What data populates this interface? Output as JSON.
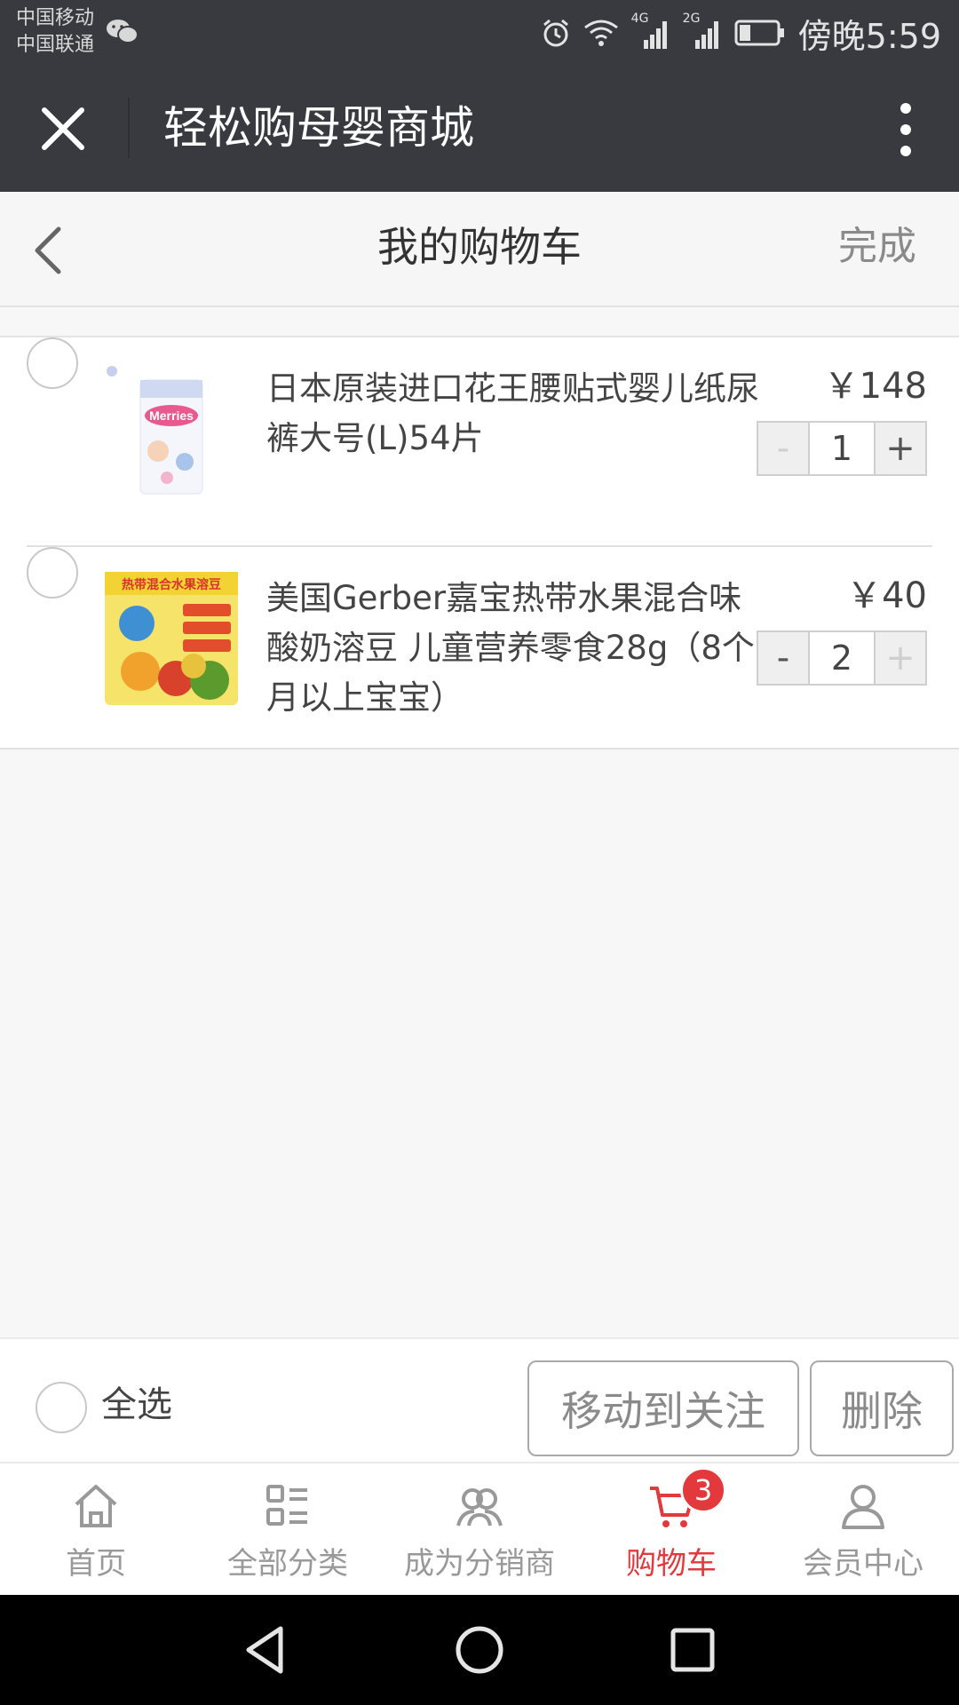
{
  "status_bar": {
    "carrier_1": "中国移动",
    "carrier_2": "中国联通",
    "network_1": "4G",
    "network_2": "2G",
    "time": "傍晚5:59"
  },
  "title_bar": {
    "title": "轻松购母婴商城"
  },
  "page_header": {
    "title": "我的购物车",
    "done_label": "完成"
  },
  "cart_items": [
    {
      "name": "日本原装进口花王腰贴式婴儿纸尿裤大号(L)54片",
      "price": "￥148",
      "quantity": "1",
      "minus_label": "-",
      "plus_label": "+",
      "image_text": "Merries"
    },
    {
      "name": "美国Gerber嘉宝热带水果混合味酸奶溶豆 儿童营养零食28g（8个月以上宝宝）",
      "price": "￥40",
      "quantity": "2",
      "minus_label": "-",
      "plus_label": "+",
      "image_text": "热带混合水果溶豆"
    }
  ],
  "action_bar": {
    "select_all_label": "全选",
    "move_to_follow_label": "移动到关注",
    "delete_label": "删除"
  },
  "tab_bar": {
    "tabs": [
      {
        "label": "首页",
        "icon": "home-icon"
      },
      {
        "label": "全部分类",
        "icon": "category-icon"
      },
      {
        "label": "成为分销商",
        "icon": "distributor-icon"
      },
      {
        "label": "购物车",
        "icon": "cart-icon",
        "badge": "3",
        "active": true
      },
      {
        "label": "会员中心",
        "icon": "user-icon"
      }
    ]
  },
  "colors": {
    "header_bg": "#393a3f",
    "accent": "#e4393c",
    "text": "#444444"
  }
}
